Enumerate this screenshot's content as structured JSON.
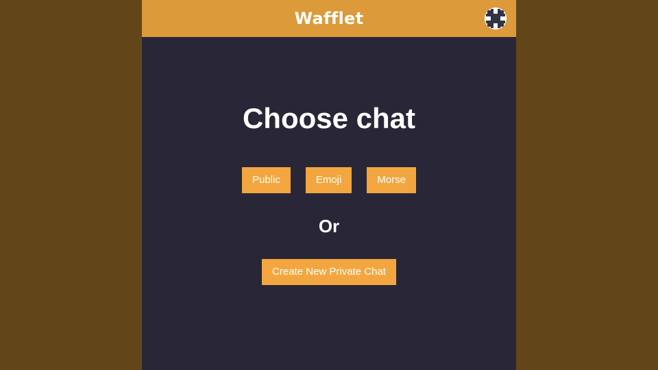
{
  "header": {
    "title": "Wafflet",
    "logo_icon": "waffle-grid-icon",
    "brand_color": "#dc9a3b"
  },
  "main": {
    "heading": "Choose chat",
    "chat_options": [
      {
        "label": "Public"
      },
      {
        "label": "Emoji"
      },
      {
        "label": "Morse"
      }
    ],
    "separator": "Or",
    "create_button_label": "Create New Private Chat",
    "button_color": "#f3a63f",
    "background_color": "#292737"
  }
}
